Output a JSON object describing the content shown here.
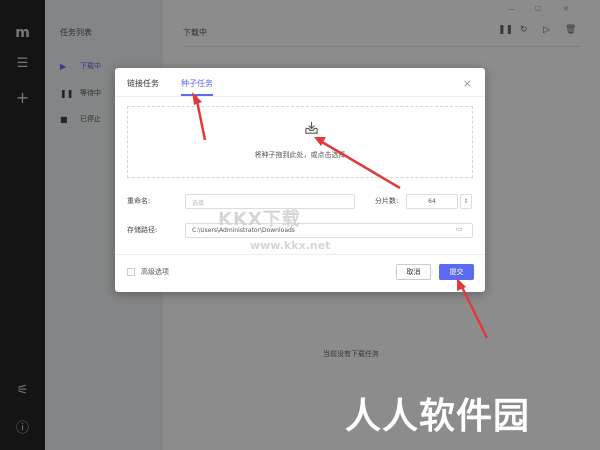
{
  "rail": {
    "logo": "m",
    "menu_icon": "menu-icon",
    "add_icon": "plus-icon",
    "settings_icon": "sliders-icon",
    "help_icon": "help-icon"
  },
  "sidebar": {
    "title": "任务列表",
    "items": [
      {
        "label": "下载中",
        "icon": "play-icon",
        "active": true
      },
      {
        "label": "等待中",
        "icon": "pause-icon",
        "active": false
      },
      {
        "label": "已停止",
        "icon": "stop-icon",
        "active": false
      }
    ]
  },
  "main": {
    "title": "下载中",
    "empty_text": "当前没有下载任务",
    "window_controls": [
      "minimize-icon",
      "maximize-icon",
      "close-icon"
    ],
    "toolbar_icons": [
      "pause-icon",
      "refresh-icon",
      "play-icon",
      "delete-icon"
    ]
  },
  "dialog": {
    "tabs": [
      {
        "label": "链接任务",
        "active": false
      },
      {
        "label": "种子任务",
        "active": true
      }
    ],
    "drop_text": "将种子拖到此处，或点击选择",
    "rename_label": "重命名:",
    "rename_placeholder": "选填",
    "split_label": "分片数:",
    "split_value": "64",
    "path_label": "存储路径:",
    "path_value": "C:\\Users\\Administrator\\Downloads",
    "advanced_label": "高级选项",
    "cancel_label": "取消",
    "ok_label": "提交",
    "accent": "#5b6bf0"
  },
  "watermarks": {
    "line1": "KKX下载",
    "line2": "www.kkx.net",
    "line3": "人人软件园"
  }
}
